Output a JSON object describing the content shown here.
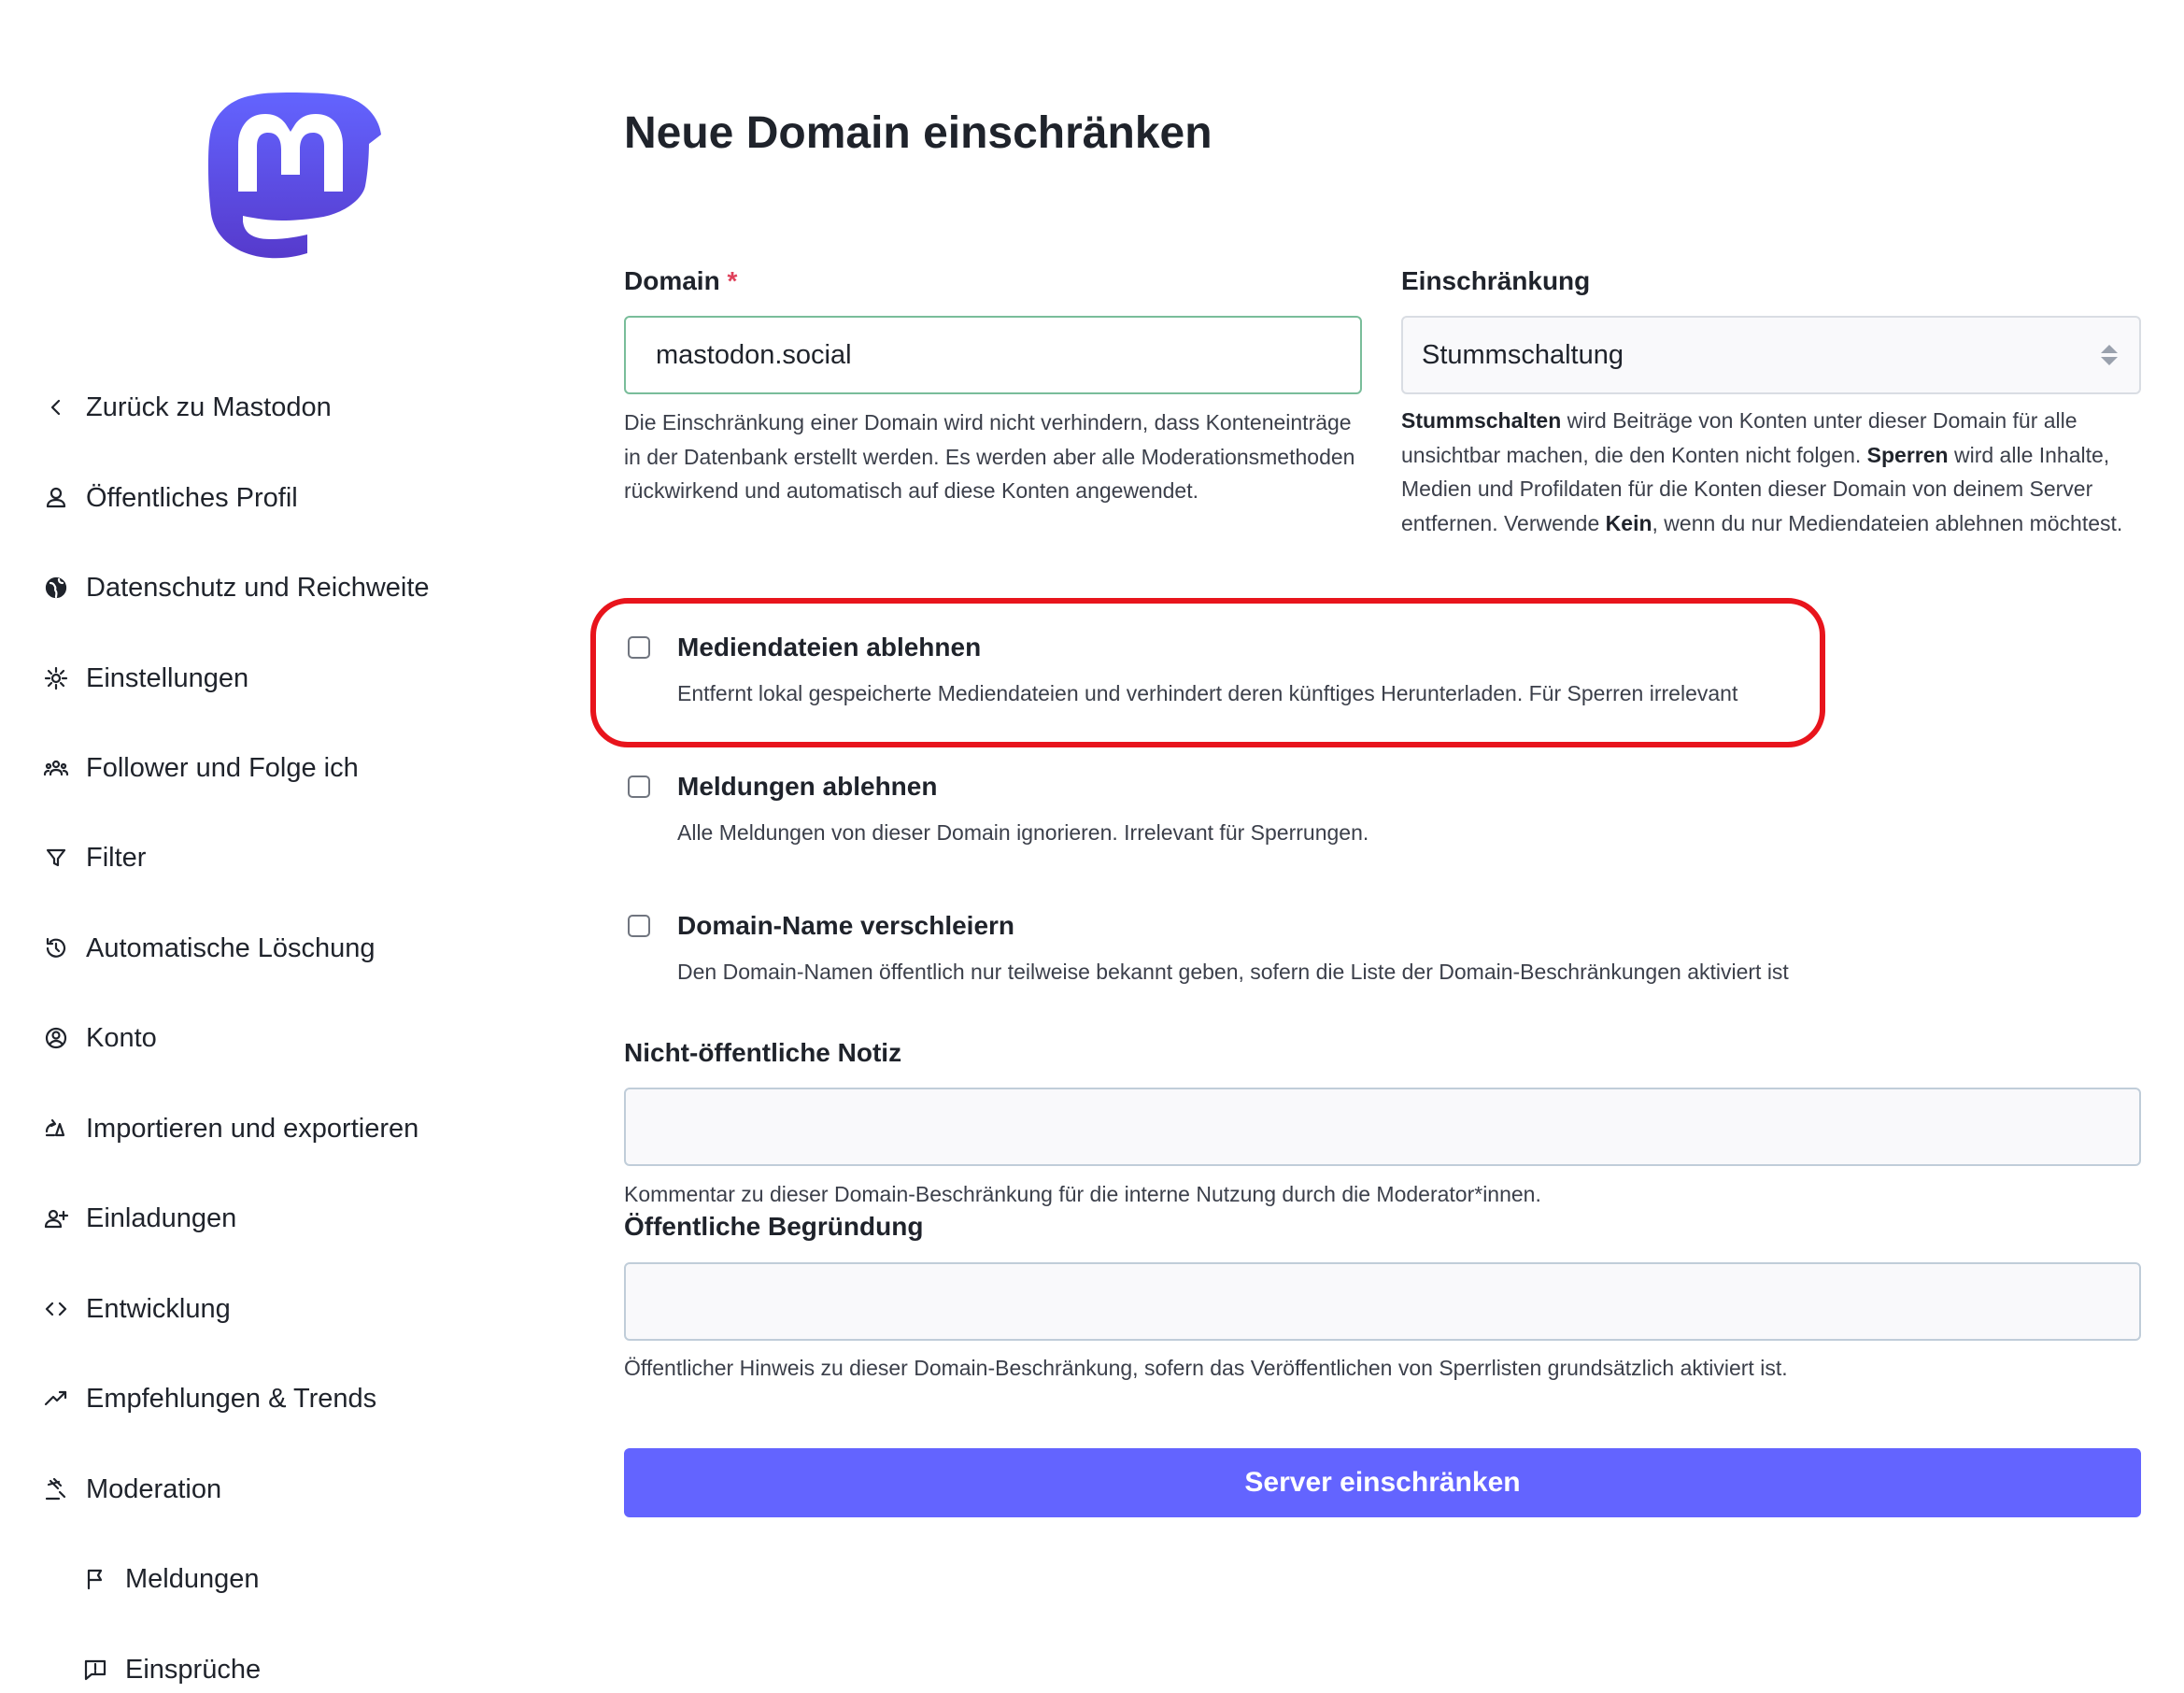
{
  "sidebar": {
    "items": [
      {
        "label": "Zurück zu Mastodon",
        "icon": "chevron-left-icon"
      },
      {
        "label": "Öffentliches Profil",
        "icon": "person-icon"
      },
      {
        "label": "Datenschutz und Reichweite",
        "icon": "globe-icon"
      },
      {
        "label": "Einstellungen",
        "icon": "gear-icon"
      },
      {
        "label": "Follower und Folge ich",
        "icon": "people-icon"
      },
      {
        "label": "Filter",
        "icon": "filter-icon"
      },
      {
        "label": "Automatische Löschung",
        "icon": "history-icon"
      },
      {
        "label": "Konto",
        "icon": "account-circle-icon"
      },
      {
        "label": "Importieren und exportieren",
        "icon": "import-export-icon"
      },
      {
        "label": "Einladungen",
        "icon": "person-add-icon"
      },
      {
        "label": "Entwicklung",
        "icon": "code-icon"
      },
      {
        "label": "Empfehlungen & Trends",
        "icon": "trending-icon"
      },
      {
        "label": "Moderation",
        "icon": "gavel-icon"
      },
      {
        "label": "Meldungen",
        "icon": "flag-icon"
      },
      {
        "label": "Einsprüche",
        "icon": "feedback-icon"
      }
    ]
  },
  "main": {
    "title": "Neue Domain einschränken",
    "domain": {
      "label": "Domain",
      "required_mark": "*",
      "value": "mastodon.social",
      "hint": "Die Einschränkung einer Domain wird nicht verhindern, dass Konteneinträge in der Datenbank erstellt werden. Es werden aber alle Moderationsmethoden rückwirkend und automatisch auf diese Konten angewendet."
    },
    "severity": {
      "label": "Einschränkung",
      "value": "Stummschaltung",
      "hint": {
        "b1": "Stummschalten",
        "t1": " wird Beiträge von Konten unter dieser Domain für alle unsichtbar machen, die den Konten nicht folgen. ",
        "b2": "Sperren",
        "t2": " wird alle Inhalte, Medien und Profildaten für die Konten dieser Domain von deinem Server entfernen. Verwende ",
        "b3": "Kein",
        "t3": ", wenn du nur Mediendateien ablehnen möchtest."
      }
    },
    "checkboxes": [
      {
        "title": "Mediendateien ablehnen",
        "desc": "Entfernt lokal gespeicherte Mediendateien und verhindert deren künftiges Herunterladen. Für Sperren irrelevant",
        "checked": false
      },
      {
        "title": "Meldungen ablehnen",
        "desc": "Alle Meldungen von dieser Domain ignorieren. Irrelevant für Sperrungen.",
        "checked": false
      },
      {
        "title": "Domain-Name verschleiern",
        "desc": "Den Domain-Namen öffentlich nur teilweise bekannt geben, sofern die Liste der Domain-Beschränkungen aktiviert ist",
        "checked": false
      }
    ],
    "private_comment": {
      "label": "Nicht-öffentliche Notiz",
      "value": "",
      "hint": "Kommentar zu dieser Domain-Beschränkung für die interne Nutzung durch die Moderator*innen."
    },
    "public_comment": {
      "label": "Öffentliche Begründung",
      "value": "",
      "hint": "Öffentlicher Hinweis zu dieser Domain-Beschränkung, sofern das Veröffentlichen von Sperrlisten grundsätzlich aktiviert ist."
    },
    "submit_label": "Server einschränken"
  },
  "colors": {
    "brand": "#6364ff",
    "highlight": "#e8141c",
    "valid_border": "#79bd9a"
  }
}
